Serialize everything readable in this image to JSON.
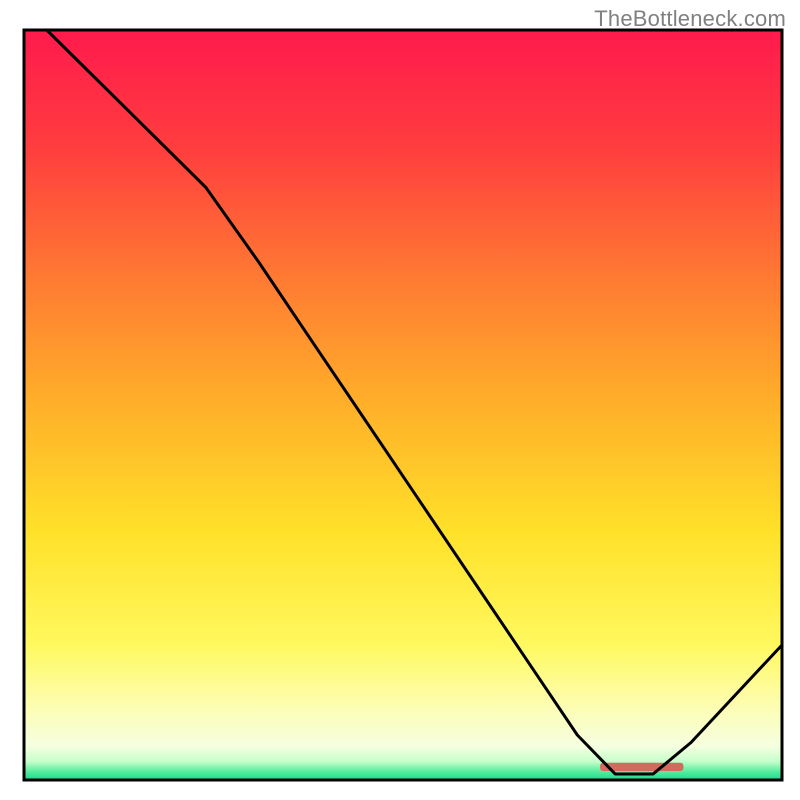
{
  "attribution": "TheBottleneck.com",
  "chart_data": {
    "type": "line",
    "title": "",
    "xlabel": "",
    "ylabel": "",
    "xlim": [
      0,
      100
    ],
    "ylim": [
      0,
      100
    ],
    "gradient_stops": [
      {
        "offset": 0,
        "color": "#ff1a4d"
      },
      {
        "offset": 0.16,
        "color": "#ff3e3e"
      },
      {
        "offset": 0.33,
        "color": "#ff7a33"
      },
      {
        "offset": 0.5,
        "color": "#ffb029"
      },
      {
        "offset": 0.67,
        "color": "#ffe129"
      },
      {
        "offset": 0.82,
        "color": "#fff95f"
      },
      {
        "offset": 0.9,
        "color": "#fdfdb0"
      },
      {
        "offset": 0.955,
        "color": "#f5ffe0"
      },
      {
        "offset": 0.975,
        "color": "#c7ffcc"
      },
      {
        "offset": 0.99,
        "color": "#4eea9b"
      },
      {
        "offset": 1.0,
        "color": "#1dd98f"
      }
    ],
    "line_series": {
      "name": "bottleneck-curve",
      "color": "#000000",
      "x": [
        3,
        10,
        17,
        24,
        31,
        38,
        45,
        52,
        59,
        66,
        73,
        78,
        83,
        88,
        100
      ],
      "y": [
        100,
        93,
        86,
        79,
        69,
        58.5,
        48,
        37.5,
        27,
        16.5,
        6,
        0.8,
        0.8,
        5,
        18
      ]
    },
    "highlight_band": {
      "name": "optimal-band",
      "color": "#d46a5e",
      "x_start": 76,
      "x_end": 87,
      "y": 1.2,
      "height": 1.1
    }
  }
}
